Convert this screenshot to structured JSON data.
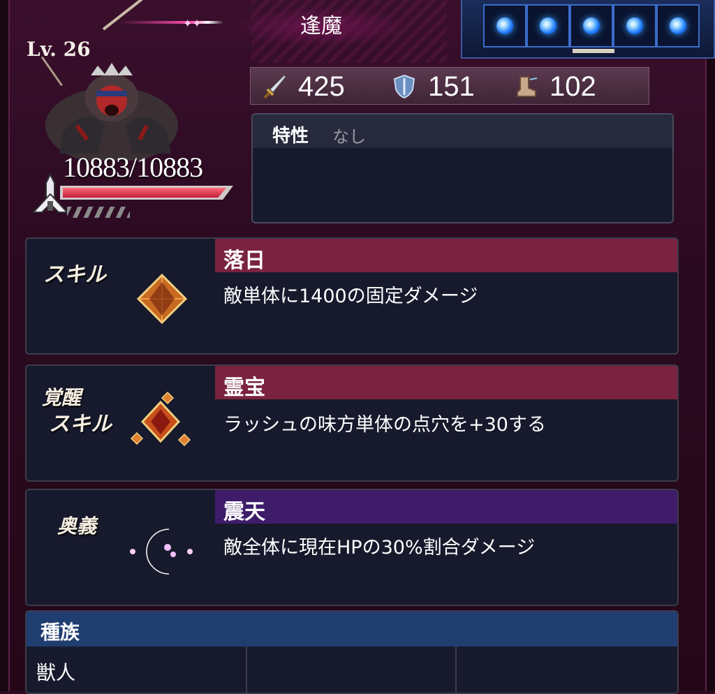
{
  "header": {
    "title": "逢魔",
    "orb_count": 5,
    "orb_color": "#1f7cff"
  },
  "unit": {
    "level_label": "Lv. 26",
    "hp_text": "10883/10883",
    "hp_current": 10883,
    "hp_max": 10883,
    "hp_bar_color": "#c01e38",
    "attack_type_icon": "sword-icon"
  },
  "stats": {
    "attack": {
      "icon": "sword-icon",
      "value": "425"
    },
    "defense": {
      "icon": "shield-icon",
      "value": "151"
    },
    "speed": {
      "icon": "boot-icon",
      "value": "102"
    }
  },
  "trait": {
    "label": "特性",
    "value": "なし"
  },
  "skills": [
    {
      "label": "スキル",
      "name": "落日",
      "description": "敵単体に1400の固定ダメージ",
      "band_color": "#7a2340",
      "icon": "orange-crystal-icon"
    },
    {
      "label_line1": "覚醒",
      "label_line2": "スキル",
      "name": "霊宝",
      "description": "ラッシュの味方単体の点穴を+30する",
      "band_color": "#7a2340",
      "icon": "crystal-cluster-icon"
    },
    {
      "label": "奥義",
      "name": "震天",
      "description": "敵全体に現在HPの30%割合ダメージ",
      "band_color": "#3e1c6a",
      "icon": "rainbow-moon-icon"
    }
  ],
  "race": {
    "header": "種族",
    "values": [
      "獣人",
      "",
      ""
    ],
    "header_color": "#203d70"
  }
}
